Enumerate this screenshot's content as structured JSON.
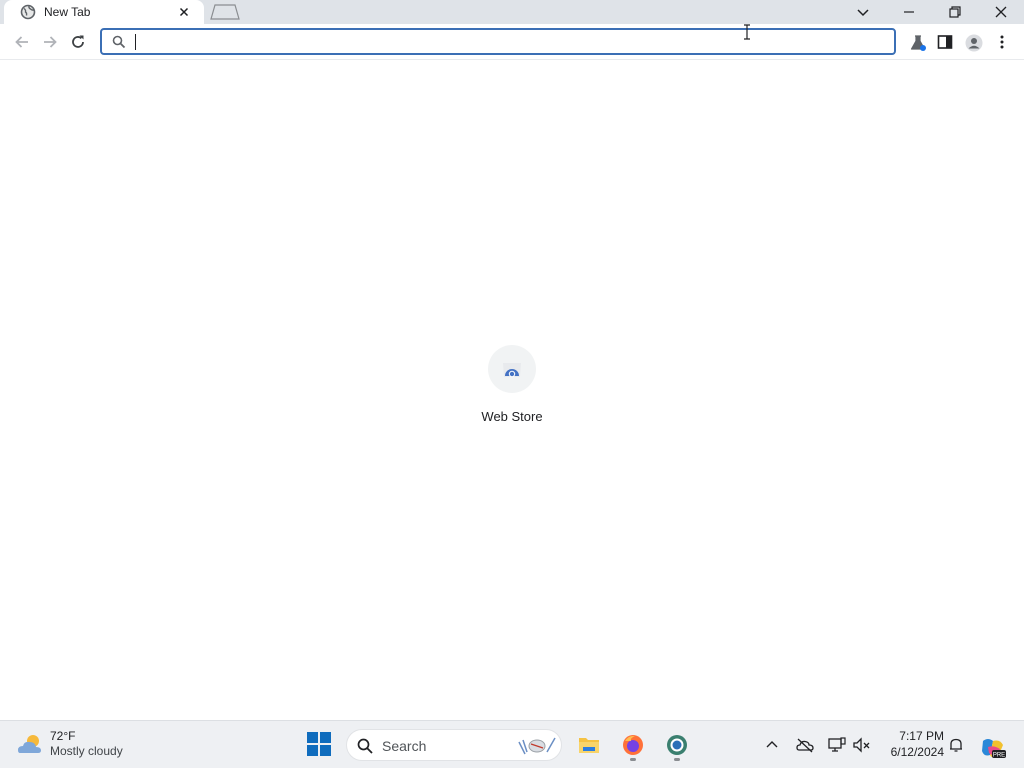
{
  "browser": {
    "tab": {
      "title": "New Tab",
      "favicon": "globe-icon"
    },
    "omnibox": {
      "value": "",
      "placeholder": ""
    }
  },
  "content": {
    "shortcuts": [
      {
        "label": "Web Store",
        "icon": "web-store-icon"
      }
    ]
  },
  "taskbar": {
    "weather": {
      "temp": "72°F",
      "condition": "Mostly cloudy"
    },
    "search_label": "Search",
    "clock": {
      "time": "7:17 PM",
      "date": "6/12/2024"
    }
  },
  "colors": {
    "omnibox_focus": "#3b6fb5",
    "windows_blue": "#0f6cbd",
    "tabstrip_bg": "#dfe3e8"
  }
}
